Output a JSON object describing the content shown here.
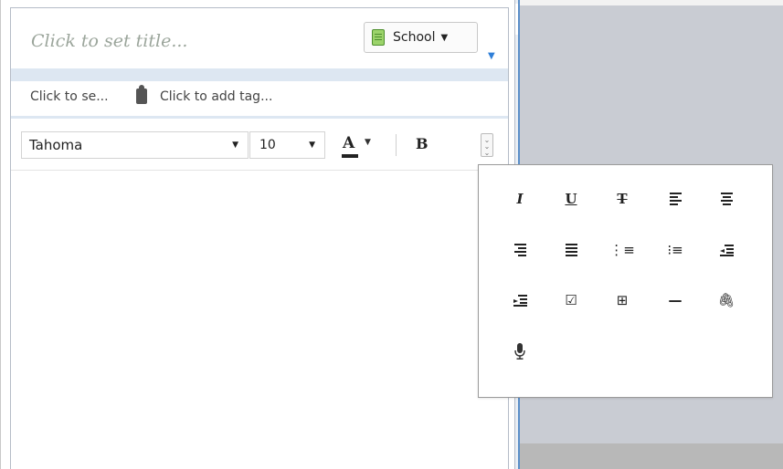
{
  "note": {
    "title_placeholder": "Click to set title...",
    "notebook": {
      "label": "School",
      "icon": "notebook-icon"
    },
    "source_placeholder": "Click to se...",
    "tag_placeholder": "Click to add tag..."
  },
  "format_bar": {
    "font": "Tahoma",
    "size": "10",
    "font_color_glyph": "A",
    "bold_glyph": "B"
  },
  "more_formatting": {
    "italic_glyph": "I",
    "underline_glyph": "U",
    "strikethrough_glyph": "T",
    "horizontal_rule_glyph": "—",
    "attachment_glyph": "🖇",
    "checkbox_glyph": "☑",
    "bullets_glyph": "⋮≡",
    "numbers_glyph": "⁝≡",
    "table_glyph": "⊞",
    "mic_glyph": "🎙"
  },
  "colors": {
    "accent": "#2f7fd8",
    "band": "#dde7f2",
    "background": "#c9ccd3"
  }
}
